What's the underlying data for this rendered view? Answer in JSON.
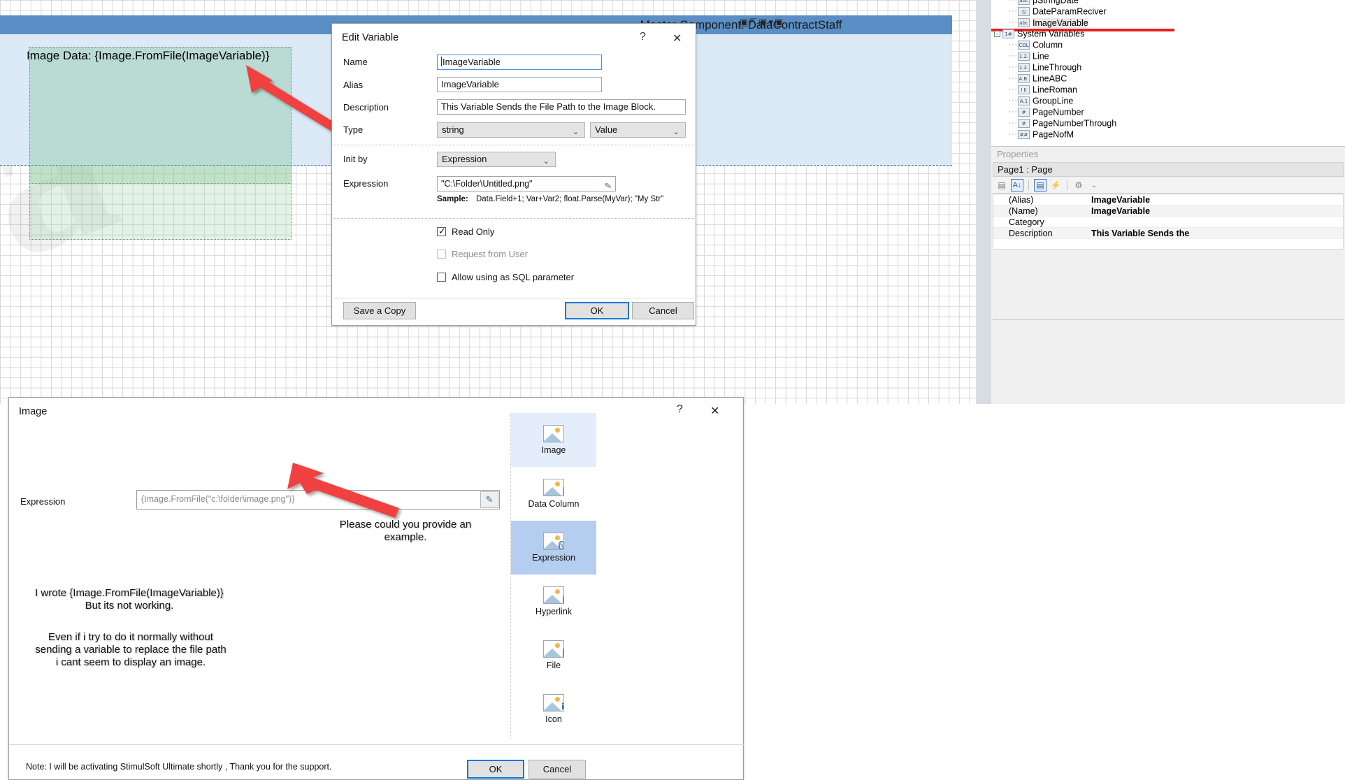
{
  "canvas": {
    "master_component_title": "Master Component: DataContractStaff",
    "image_block_label": "Image Data: {Image.FromFile(ImageVariable)}",
    "watermark_text": "a"
  },
  "tree": {
    "items": [
      {
        "label": "pStringDate",
        "icon": "abc-icon",
        "icon_text": "abc",
        "indent": 2,
        "partial": true
      },
      {
        "label": "DateParamReciver",
        "icon": "clock-icon",
        "icon_text": "◷",
        "indent": 2,
        "partial": false
      },
      {
        "label": "ImageVariable",
        "icon": "abc-icon",
        "icon_text": "abc",
        "indent": 2,
        "partial": false,
        "selected": true
      },
      {
        "label": "System Variables",
        "icon": "system-variables-icon",
        "icon_text": "1#",
        "indent": 1,
        "expandable": true
      },
      {
        "label": "Column",
        "icon": "column-icon",
        "icon_text": "COL",
        "indent": 2
      },
      {
        "label": "Line",
        "icon": "number-icon",
        "icon_text": "1.2.",
        "indent": 2
      },
      {
        "label": "LineThrough",
        "icon": "number-icon",
        "icon_text": "1.2.",
        "indent": 2
      },
      {
        "label": "LineABC",
        "icon": "alpha-icon",
        "icon_text": "A.B.",
        "indent": 2
      },
      {
        "label": "LineRoman",
        "icon": "roman-icon",
        "icon_text": "I II",
        "indent": 2
      },
      {
        "label": "GroupLine",
        "icon": "groupline-icon",
        "icon_text": "A.1",
        "indent": 2
      },
      {
        "label": "PageNumber",
        "icon": "hash-icon",
        "icon_text": "#",
        "indent": 2
      },
      {
        "label": "PageNumberThrough",
        "icon": "hash-icon",
        "icon_text": "#",
        "indent": 2
      },
      {
        "label": "PageNofM",
        "icon": "double-hash-icon",
        "icon_text": "##",
        "indent": 2
      }
    ]
  },
  "properties": {
    "caption": "Properties",
    "object": "Page1 : Page",
    "toolbar": [
      {
        "name": "categorized-icon",
        "glyph": "▤"
      },
      {
        "name": "alphabetical-sort-icon",
        "glyph": "A↓"
      },
      {
        "name": "properties-view-icon",
        "glyph": "▣"
      },
      {
        "name": "events-icon",
        "glyph": "⚡"
      },
      {
        "name": "settings-gear-icon",
        "glyph": "⚙"
      },
      {
        "name": "chevron-down-icon",
        "glyph": "⌄"
      }
    ],
    "rows": [
      {
        "key": "(Alias)",
        "value": "ImageVariable"
      },
      {
        "key": "(Name)",
        "value": "ImageVariable"
      },
      {
        "key": "Category",
        "value": ""
      },
      {
        "key": "Description",
        "value": "This Variable Sends the"
      }
    ]
  },
  "edit_variable_dialog": {
    "title": "Edit Variable",
    "help_glyph": "?",
    "close_glyph": "✕",
    "fields": {
      "name_label": "Name",
      "name_value": "ImageVariable",
      "alias_label": "Alias",
      "alias_value": "ImageVariable",
      "description_label": "Description",
      "description_value": "This Variable Sends the File Path to the Image Block.",
      "type_label": "Type",
      "type_value": "string",
      "type_kind_value": "Value",
      "init_by_label": "Init by",
      "init_by_value": "Expression",
      "expression_label": "Expression",
      "expression_value": "\"C:\\Folder\\Untitled.png\"",
      "sample_label": "Sample:",
      "sample_value": "Data.Field+1; Var+Var2; float.Parse(MyVar); \"My Str\""
    },
    "checkboxes": [
      {
        "label": "Read Only",
        "checked": true,
        "disabled": false
      },
      {
        "label": "Request from User",
        "checked": false,
        "disabled": true
      },
      {
        "label": "Allow using as SQL parameter",
        "checked": false,
        "disabled": false
      }
    ],
    "buttons": {
      "save_a_copy": "Save a Copy",
      "ok": "OK",
      "cancel": "Cancel"
    }
  },
  "image_dialog": {
    "title": "Image",
    "help_glyph": "?",
    "close_glyph": "✕",
    "expression_label": "Expression",
    "expression_placeholder": "{Image.FromFile(\"c:\\folder\\image.png\")}",
    "edit_button_glyph": "✎",
    "note": "Note: I will be activating StimulSoft Ultimate shortly , Thank you for the support.",
    "buttons": {
      "ok": "OK",
      "cancel": "Cancel"
    },
    "source_types": [
      {
        "label": "Image",
        "icon": "image-icon",
        "state": "hover"
      },
      {
        "label": "Data Column",
        "icon": "data-column-icon",
        "state": "normal"
      },
      {
        "label": "Expression",
        "icon": "expression-icon",
        "state": "selected"
      },
      {
        "label": "Hyperlink",
        "icon": "hyperlink-icon",
        "state": "normal"
      },
      {
        "label": "File",
        "icon": "file-icon",
        "state": "normal"
      },
      {
        "label": "Icon",
        "icon": "icon-icon",
        "state": "normal"
      }
    ]
  },
  "annotations": {
    "please_example": "Please could you provide an\nexample.",
    "i_wrote": "I wrote {Image.FromFile(ImageVariable)}\nBut its not working.",
    "even_if": "Even if i try to do it normally without\nsending a variable to replace the file path\ni cant seem to display an image."
  },
  "colors": {
    "accent_blue": "#0078d7",
    "annotation_red": "#f0413f",
    "band_blue": "#5a8ec4",
    "selection_blue": "#b5cdef",
    "underline_red": "#e8201c"
  }
}
